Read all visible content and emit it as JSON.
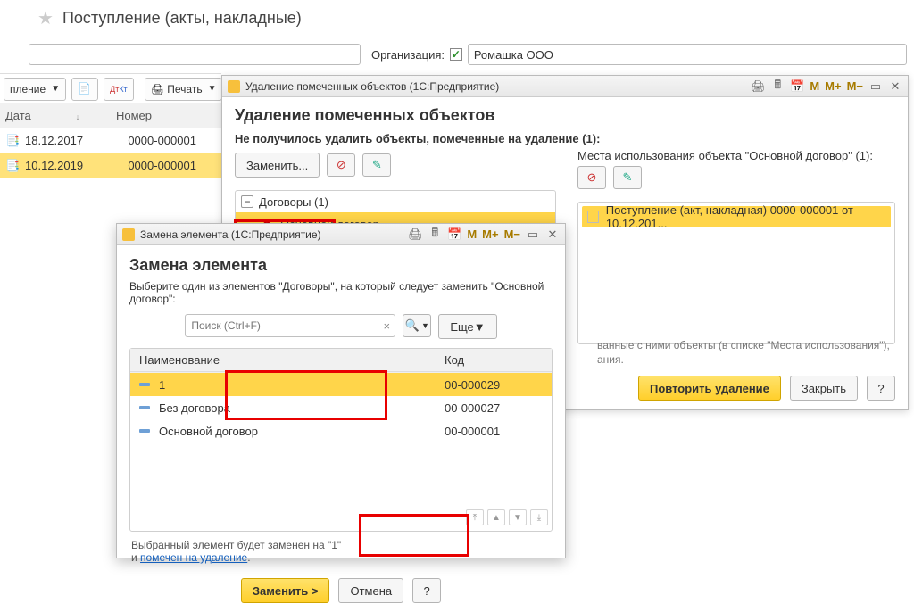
{
  "page": {
    "title": "Поступление (акты, накладные)"
  },
  "filter": {
    "org_label": "Организация:",
    "org_value": "Ромашка ООО"
  },
  "toolbar": {
    "item_label": "пление",
    "print_label": "Печать"
  },
  "grid": {
    "col_date": "Дата",
    "col_number": "Номер",
    "rows": [
      {
        "date": "18.12.2017",
        "number": "0000-000001"
      },
      {
        "date": "10.12.2019",
        "number": "0000-000001"
      }
    ]
  },
  "win_del": {
    "titlebar": "Удаление помеченных объектов (1С:Предприятие)",
    "heading": "Удаление помеченных объектов",
    "fail_text": "Не получилось удалить объекты, помеченные на удаление (1):",
    "replace_btn": "Заменить...",
    "tree_group": "Договоры (1)",
    "tree_item": "Основной договор",
    "usage_heading": "Места использования объекта \"Основной договор\" (1):",
    "usage_item": "Поступление (акт, накладная) 0000-000001 от 10.12.201...",
    "hint_a": "ванные с ними объекты (в списке \"Места использования\"),",
    "hint_b": "ания.",
    "retry_btn": "Повторить удаление",
    "close_btn": "Закрыть",
    "help_btn": "?"
  },
  "win_rep": {
    "titlebar": "Замена элемента (1С:Предприятие)",
    "heading": "Замена элемента",
    "instruction": "Выберите один из элементов \"Договоры\", на который следует заменить \"Основной договор\":",
    "search_placeholder": "Поиск (Ctrl+F)",
    "more_btn": "Еще",
    "col_name": "Наименование",
    "col_code": "Код",
    "rows": [
      {
        "name": "1",
        "code": "00-000029"
      },
      {
        "name": "Без договора",
        "code": "00-000027"
      },
      {
        "name": "Основной договор",
        "code": "00-000001"
      }
    ],
    "footer_text": "Выбранный элемент будет заменен на \"1\"",
    "footer_text2": "и ",
    "footer_link": "помечен на удаление",
    "apply_btn": "Заменить >",
    "cancel_btn": "Отмена",
    "help_btn": "?"
  },
  "mem_buttons": {
    "m": "M",
    "mp": "M+",
    "mm": "M−"
  }
}
